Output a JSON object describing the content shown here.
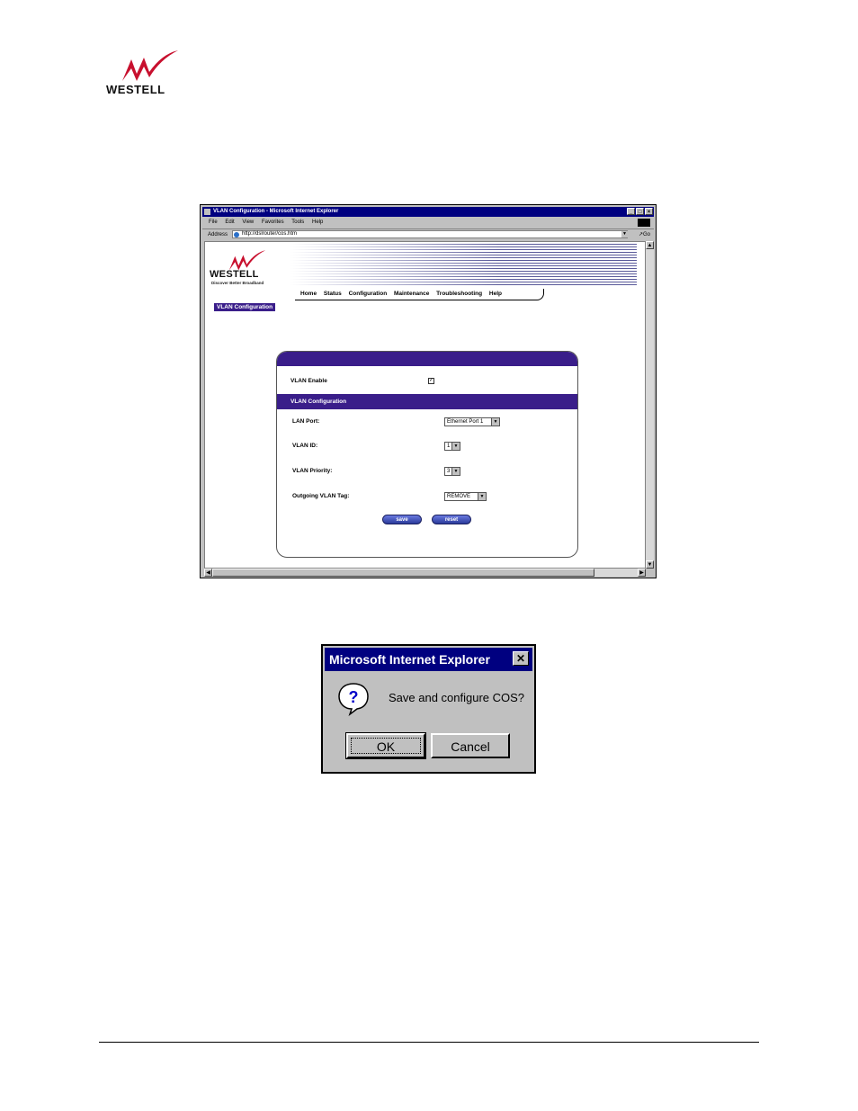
{
  "document": {
    "logo_text": "WESTELL"
  },
  "browser": {
    "title": "VLAN Configuration - Microsoft Internet Explorer",
    "window_buttons": [
      "_",
      "□",
      "×"
    ],
    "menu": [
      "File",
      "Edit",
      "View",
      "Favorites",
      "Tools",
      "Help"
    ],
    "address_label": "Address",
    "address_value": "http://dslrouter/cos.htm",
    "go_label": "Go"
  },
  "webpage": {
    "logo_text": "WESTELL",
    "tagline": "Discover Better Broadband",
    "nav": [
      "Home",
      "Status",
      "Configuration",
      "Maintenance",
      "Troubleshooting",
      "Help"
    ],
    "page_tab": "VLAN Configuration",
    "form": {
      "vlan_enable_label": "VLAN Enable",
      "vlan_enable_checked": true,
      "section_title": "VLAN Configuration",
      "lan_port_label": "LAN Port:",
      "lan_port_value": "Ethernet Port 1",
      "vlan_id_label": "VLAN ID:",
      "vlan_id_value": "1",
      "vlan_priority_label": "VLAN Priority:",
      "vlan_priority_value": "3",
      "outgoing_tag_label": "Outgoing VLAN Tag:",
      "outgoing_tag_value": "REMOVE",
      "save_label": "save",
      "reset_label": "reset"
    }
  },
  "dialog": {
    "title": "Microsoft Internet Explorer",
    "message": "Save and configure COS?",
    "ok_label": "OK",
    "cancel_label": "Cancel"
  },
  "colors": {
    "titlebar": "#000080",
    "brand_purple": "#3a1e8a",
    "logo_red": "#c8102e"
  }
}
